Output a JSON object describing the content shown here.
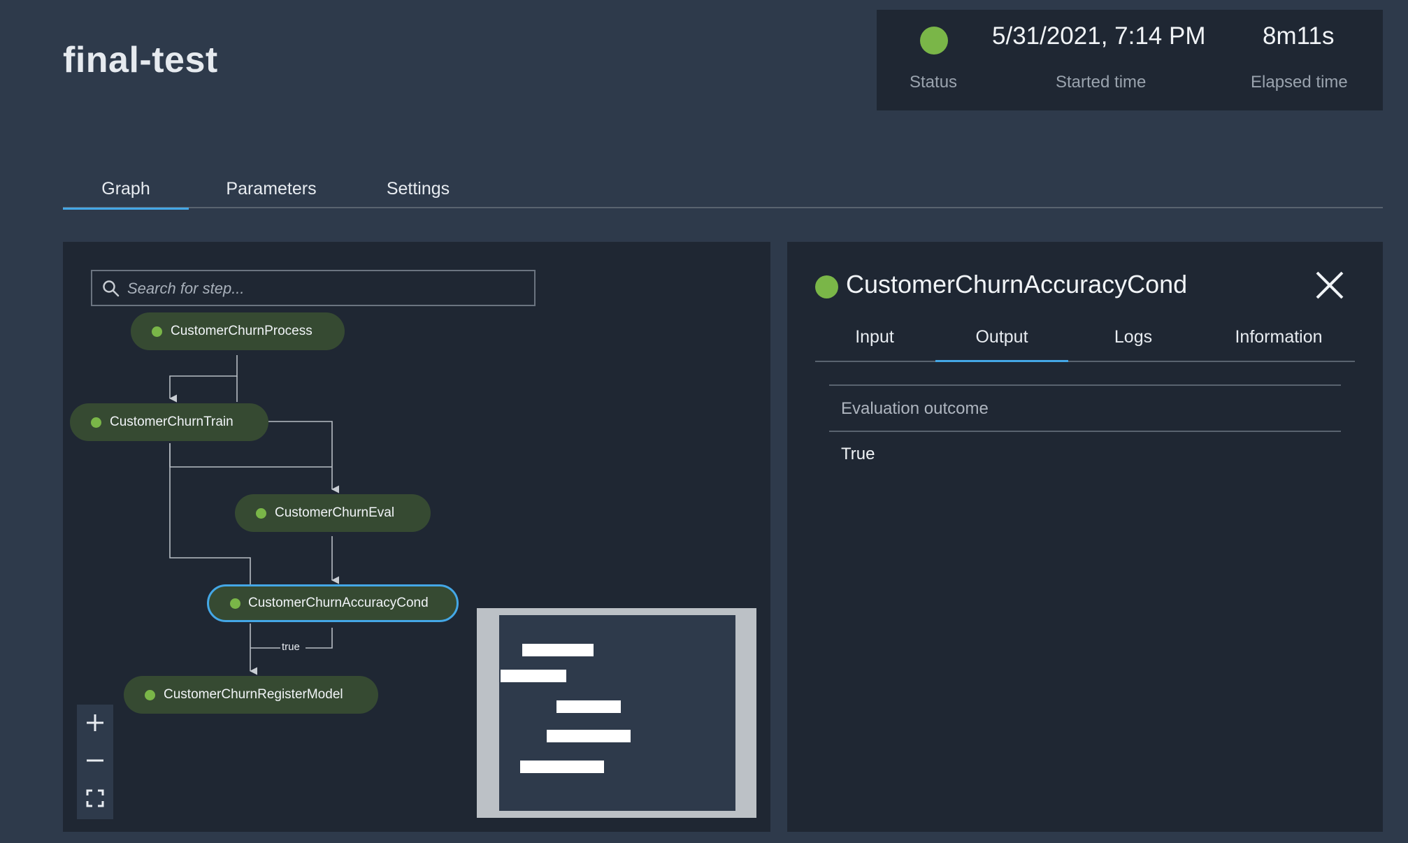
{
  "pipeline": {
    "title": "final-test",
    "status_label": "Status",
    "started_time_value": "5/31/2021, 7:14 PM",
    "started_time_label": "Started time",
    "elapsed_time_value": "8m11s",
    "elapsed_time_label": "Elapsed time",
    "status_color": "#7ab648"
  },
  "tabs": [
    {
      "label": "Graph",
      "active": true
    },
    {
      "label": "Parameters",
      "active": false
    },
    {
      "label": "Settings",
      "active": false
    }
  ],
  "graph": {
    "search_placeholder": "Search for step...",
    "nodes": [
      {
        "label": "CustomerChurnProcess",
        "status": "succeeded"
      },
      {
        "label": "CustomerChurnTrain",
        "status": "succeeded"
      },
      {
        "label": "CustomerChurnEval",
        "status": "succeeded"
      },
      {
        "label": "CustomerChurnAccuracyCond",
        "status": "succeeded",
        "selected": true
      },
      {
        "label": "CustomerChurnRegisterModel",
        "status": "succeeded"
      }
    ],
    "edge_label_true": "true",
    "zoom_controls": [
      "plus-icon",
      "minus-icon",
      "fit-screen-icon"
    ]
  },
  "detail": {
    "step_name": "CustomerChurnAccuracyCond",
    "tabs": [
      {
        "label": "Input",
        "active": false
      },
      {
        "label": "Output",
        "active": true
      },
      {
        "label": "Logs",
        "active": false
      },
      {
        "label": "Information",
        "active": false
      }
    ],
    "output": {
      "header": "Evaluation outcome",
      "value": "True"
    }
  },
  "colors": {
    "background": "#2e3a4b",
    "panel": "#1f2733",
    "node": "#364a32",
    "success": "#7ab648",
    "accent": "#44a7e6"
  }
}
